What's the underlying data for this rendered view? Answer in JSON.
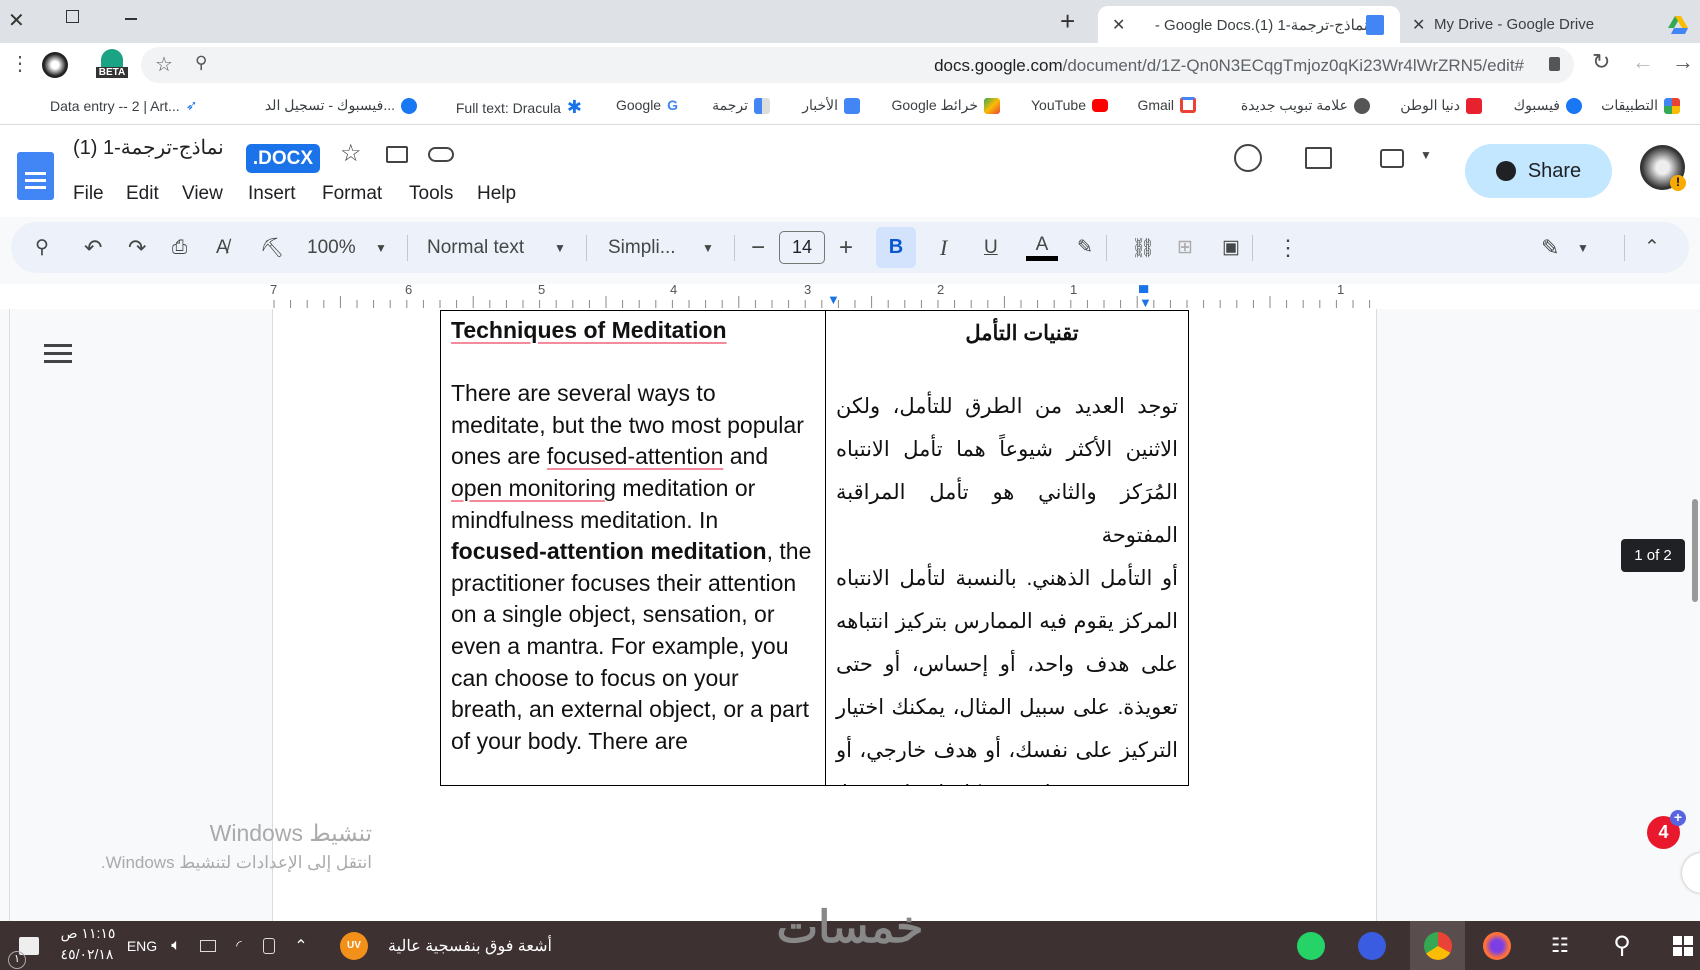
{
  "browser": {
    "tabs": [
      {
        "title": "نماذج-ترجمة-1 (1).Google Docs -",
        "active": true,
        "icon": "google-docs-icon"
      },
      {
        "title": "My Drive - Google Drive",
        "active": false,
        "icon": "google-drive-icon"
      }
    ],
    "url_host": "docs.google.com",
    "url_path": "/document/d/1Z-Qn0N3ECqgTmjoz0qKi23Wr4lWrZRN5/edit#",
    "extension_badge": "BETA",
    "bookmarks": [
      "التطبيقات",
      "فيسبوك",
      "دنيا الوطن",
      "علامة تبويب جديدة",
      "Gmail",
      "YouTube",
      "Google خرائط",
      "الأخبار",
      "ترجمة",
      "Google",
      "Full text: Dracula",
      "فيسبوك - تسجيل الد...",
      "Data entry -- 2 | Art..."
    ]
  },
  "docs": {
    "title": "نماذج-ترجمة-1 (1)",
    "badge": ".DOCX",
    "menu": [
      "File",
      "Edit",
      "View",
      "Insert",
      "Format",
      "Tools",
      "Help"
    ],
    "share_label": "Share",
    "toolbar": {
      "zoom": "100%",
      "style": "Normal text",
      "font": "Simpli...",
      "font_size": "14",
      "bold_active": true
    },
    "ruler": [
      "7",
      "6",
      "5",
      "4",
      "3",
      "2",
      "1",
      "1"
    ],
    "page_indicator": "1 of 2",
    "notification_count": "4",
    "accent": "#1a73e8"
  },
  "document": {
    "en_heading": "Techniques of Meditation",
    "en": {
      "p1": "There are several ways to meditate, but the two most popular ones are ",
      "u1": "focused-attention",
      "p2": " and ",
      "u2": "open monitoring",
      "p3": " meditation or mindfulness meditation. In ",
      "b1": "focused-attention meditation",
      "p4": ", the practitioner focuses their attention on a single object, sensation, or even a mantra. For example, you can choose to focus on your breath, an external object, or a part of your body. There are"
    },
    "ar_heading": "تقنيات التأمل",
    "ar_lines": [
      "توجد العديد من الطرق للتأمل، ولكن",
      "الاثنين الأكثر شيوعاً هما تأمل الانتباه",
      "المُرَكز والثاني هو تأمل المراقبة المفتوحة",
      "أو التأمل الذهني. بالنسبة لتأمل الانتباه",
      "المركز يقوم فيه الممارس بتركيز انتباهه",
      "على هدف واحد، أو إحساس، أو حتى",
      "تعويذة. على سبيل المثال، يمكنك اختيار",
      "التركيز على نفسك، أو هدف خارجي، أو",
      "جزء من جسمك. وبشكل افتراضي فلا"
    ]
  },
  "windows_activation": {
    "title": "تنشيط Windows",
    "subtitle": "انتقل إلى الإعدادات لتنشيط Windows."
  },
  "taskbar": {
    "time": "١١:١٥ ص",
    "date": "٤٥/٠٢/١٨",
    "language": "ENG",
    "weather_badge": "UV",
    "weather_text": "أشعة فوق بنفسجية عالية",
    "notification_count": "١",
    "watermark": "خمسات"
  }
}
